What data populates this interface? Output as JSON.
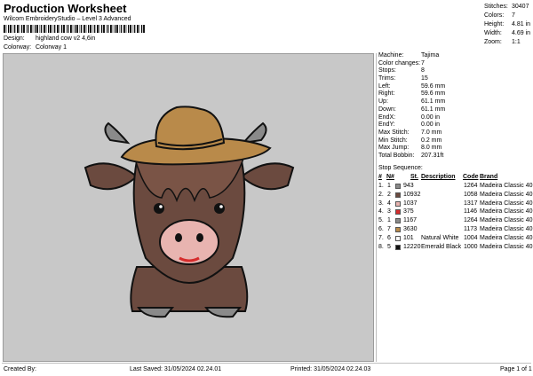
{
  "header": {
    "title": "Production Worksheet",
    "subtitle": "Wilcom EmbroideryStudio – Level 3 Advanced",
    "design_label": "Design:",
    "design_value": "highland cow v2 4,6in",
    "colorway_label": "Colorway:",
    "colorway_value": "Colorway 1"
  },
  "summary": [
    {
      "label": "Stitches:",
      "value": "30407"
    },
    {
      "label": "Colors:",
      "value": "7"
    },
    {
      "label": "Height:",
      "value": "4.81 in"
    },
    {
      "label": "Width:",
      "value": "4.69 in"
    },
    {
      "label": "Zoom:",
      "value": "1:1"
    }
  ],
  "machine_info": [
    {
      "label": "Machine:",
      "value": "Tajima"
    },
    {
      "label": "Color changes:",
      "value": "7"
    },
    {
      "label": "Stops:",
      "value": "8"
    },
    {
      "label": "Trims:",
      "value": "15"
    },
    {
      "label": "Left:",
      "value": "59.6 mm"
    },
    {
      "label": "Right:",
      "value": "59.6 mm"
    },
    {
      "label": "Up:",
      "value": "61.1 mm"
    },
    {
      "label": "Down:",
      "value": "61.1 mm"
    },
    {
      "label": "EndX:",
      "value": "0.00 in"
    },
    {
      "label": "EndY:",
      "value": "0.00 in"
    },
    {
      "label": "Max Stitch:",
      "value": "7.0 mm"
    },
    {
      "label": "Min Stitch:",
      "value": "0.2 mm"
    },
    {
      "label": "Max Jump:",
      "value": "8.0 mm"
    },
    {
      "label": "Total Bobbin:",
      "value": "207.31ft"
    }
  ],
  "stop_sequence": {
    "title": "Stop Sequence:",
    "columns": {
      "num": "#",
      "n": "N#",
      "st": "St.",
      "desc": "Description",
      "code": "Code",
      "brand": "Brand"
    },
    "rows": [
      {
        "num": "1.",
        "n": "1",
        "color": "#8a8a8a",
        "st": "943",
        "desc": "",
        "code": "1264",
        "brand": "Madeira Classic 40"
      },
      {
        "num": "2.",
        "n": "2",
        "color": "#6b4a3f",
        "st": "10932",
        "desc": "",
        "code": "1058",
        "brand": "Madeira Classic 40"
      },
      {
        "num": "3.",
        "n": "4",
        "color": "#e8b4b0",
        "st": "1037",
        "desc": "",
        "code": "1317",
        "brand": "Madeira Classic 40"
      },
      {
        "num": "4.",
        "n": "3",
        "color": "#d62c2c",
        "st": "375",
        "desc": "",
        "code": "1146",
        "brand": "Madeira Classic 40"
      },
      {
        "num": "5.",
        "n": "1",
        "color": "#8a8a8a",
        "st": "1167",
        "desc": "",
        "code": "1264",
        "brand": "Madeira Classic 40"
      },
      {
        "num": "6.",
        "n": "7",
        "color": "#b98a4a",
        "st": "3630",
        "desc": "",
        "code": "1173",
        "brand": "Madeira Classic 40"
      },
      {
        "num": "7.",
        "n": "6",
        "color": "#ffffff",
        "st": "101",
        "desc": "Natural White",
        "code": "1004",
        "brand": "Madeira Classic 40"
      },
      {
        "num": "8.",
        "n": "5",
        "color": "#111111",
        "st": "12220",
        "desc": "Emerald Black",
        "code": "1000",
        "brand": "Madeira Classic 40"
      }
    ]
  },
  "footer": {
    "created_by": "Created By:",
    "last_saved": "Last Saved: 31/05/2024 02.24.01",
    "printed": "Printed: 31/05/2024 02.24.03",
    "page": "Page 1 of 1"
  },
  "preview": {
    "background": "#c8c8c8",
    "colors": {
      "hair": "#6b4a3f",
      "hat": "#b98a4a",
      "horn": "#8a8a8a",
      "muzzle": "#e8b4b0",
      "mouth": "#d62c2c",
      "outline": "#111111"
    }
  }
}
